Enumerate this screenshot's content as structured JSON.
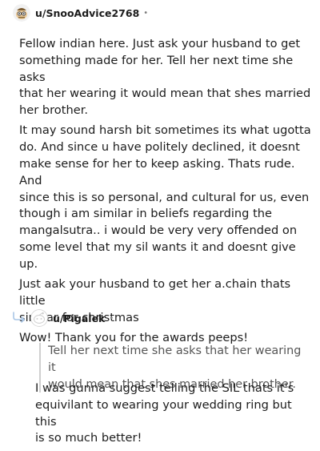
{
  "comments": [
    {
      "username": "u/SnooAdvice2768",
      "separator": "•",
      "paragraphs": [
        [
          "Fellow indian here. Just ask your husband to get",
          "something made for her. Tell her next time she asks",
          "that her wearing it would mean that shes married",
          "her brother."
        ],
        [
          "It may sound harsh bit sometimes its what ugotta",
          "do. And since u have politely declined, it doesnt",
          "make sense for her to keep asking. Thats rude. And",
          "since this is so personal, and cultural for us, even",
          "though i am similar in beliefs regarding the",
          "mangalsutra.. i would be very very offended on",
          "some level that my sil wants it and doesnt give up."
        ],
        [
          "Just aak your husband to get her a.chain thats little",
          "similar for christmas"
        ],
        [
          "Wow! Thank you for the awards peeps!"
        ]
      ]
    },
    {
      "username": "u/Pigalek",
      "separator": "•",
      "quote": [
        "Tell her next time she asks that her wearing it",
        "would mean that shes married her brother."
      ],
      "paragraphs": [
        [
          "I was gunna suggest telling the SIL thats it's",
          "equivilant to wearing your wedding ring but this",
          "is so much better!"
        ]
      ]
    }
  ],
  "icons": {
    "avatar_1": "snoo-avatar-icon",
    "avatar_2": "default-avatar-icon",
    "reply": "reply-arrow-icon"
  },
  "colors": {
    "text": "#1c1c1c",
    "muted": "#7c7c7c",
    "quote_bar": "#cfcfcf"
  }
}
